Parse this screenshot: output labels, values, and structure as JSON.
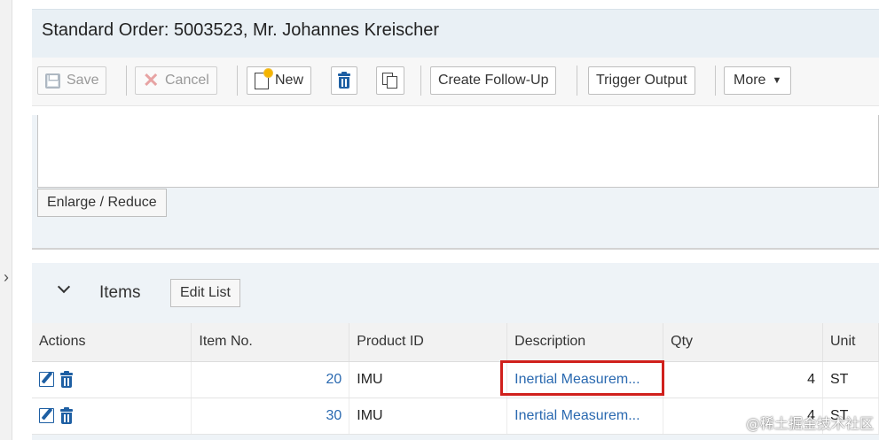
{
  "page": {
    "title": "Standard Order: 5003523, Mr. Johannes Kreischer"
  },
  "toolbar": {
    "save_label": "Save",
    "cancel_label": "Cancel",
    "new_label": "New",
    "create_follow_up_label": "Create Follow-Up",
    "trigger_output_label": "Trigger Output",
    "more_label": "More"
  },
  "notes_panel": {
    "enlarge_reduce_label": "Enlarge / Reduce"
  },
  "items": {
    "section_title": "Items",
    "edit_list_label": "Edit List",
    "columns": {
      "actions": "Actions",
      "item_no": "Item No.",
      "product_id": "Product ID",
      "description": "Description",
      "qty": "Qty",
      "unit": "Unit"
    },
    "rows": [
      {
        "item_no": "20",
        "product_id": "IMU",
        "description": "Inertial Measurem...",
        "qty": "4",
        "unit": "ST"
      },
      {
        "item_no": "30",
        "product_id": "IMU",
        "description": "Inertial Measurem...",
        "qty": "4",
        "unit": "ST"
      }
    ]
  },
  "watermark": "@稀土掘金技术社区",
  "icons": {
    "save": "save-icon",
    "cancel": "cancel-icon",
    "new": "new-document-icon",
    "delete": "trash-icon",
    "copy": "copy-icon",
    "more": "caret-down-icon",
    "edit": "edit-icon",
    "sidebar_toggle": "chevron-right-icon",
    "section_collapse": "chevron-down-icon"
  },
  "colors": {
    "header_bg": "#e9f0f5",
    "link_blue": "#2a69b0",
    "icon_blue": "#1e5fa3",
    "highlight_red": "#d0201c"
  }
}
